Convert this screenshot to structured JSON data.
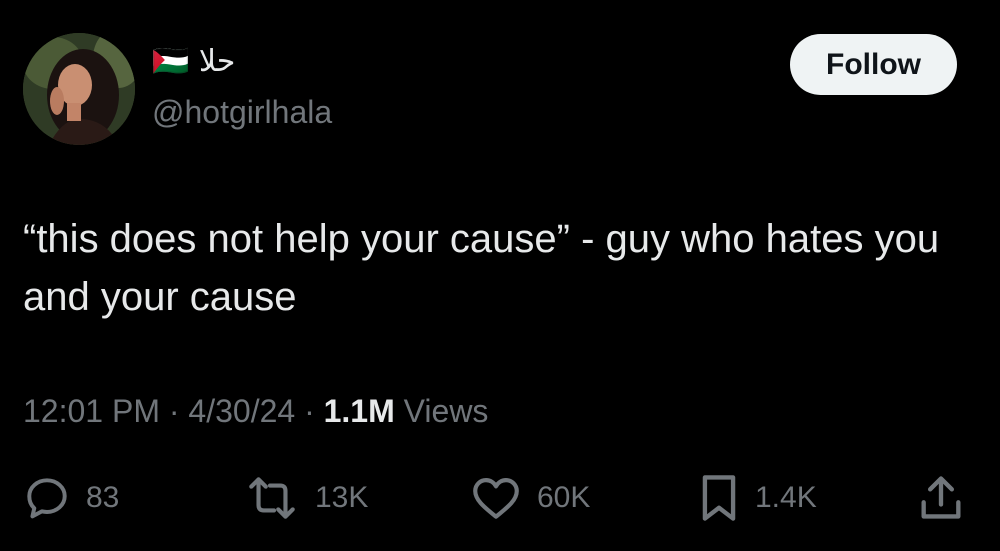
{
  "author": {
    "display_name": "حلا 🇵🇸",
    "handle": "@hotgirlhala"
  },
  "follow_button": {
    "label": "Follow"
  },
  "tweet": {
    "text": "“this does not help your cause” - guy who hates you and your cause",
    "time": "12:01 PM",
    "date": "4/30/24",
    "separator": "·",
    "views_count": "1.1M",
    "views_label": "Views"
  },
  "actions": {
    "replies": "83",
    "reposts": "13K",
    "likes": "60K",
    "bookmarks": "1.4K"
  },
  "icons": {
    "reply": "reply-icon",
    "repost": "repost-icon",
    "like": "heart-icon",
    "bookmark": "bookmark-icon",
    "share": "share-icon"
  },
  "colors": {
    "background": "#000000",
    "primary_text": "#e7e9ea",
    "secondary_text": "#71767b",
    "follow_button_bg": "#eff3f4",
    "follow_button_text": "#0f1419"
  }
}
